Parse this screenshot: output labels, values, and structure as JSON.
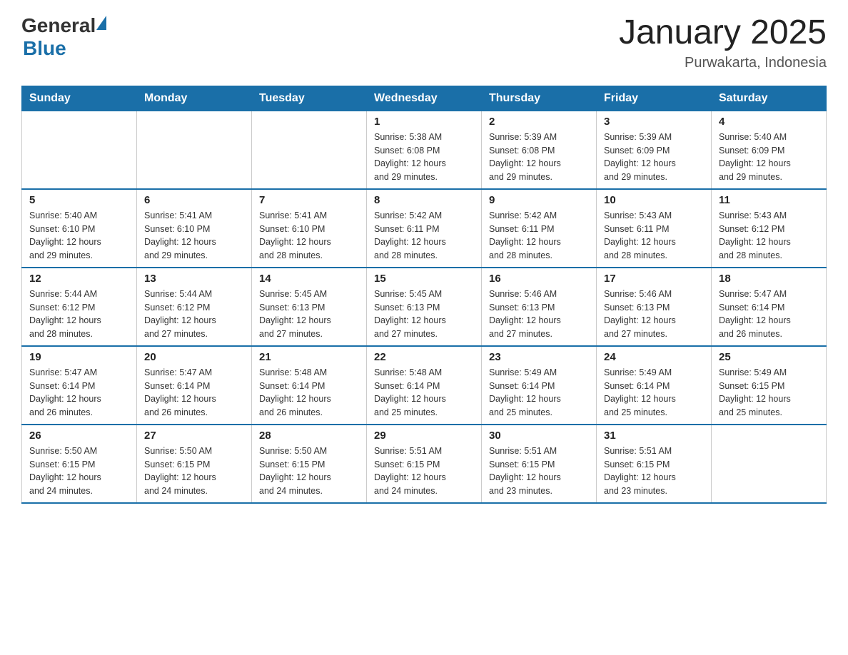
{
  "header": {
    "logo_general": "General",
    "logo_blue": "Blue",
    "month_title": "January 2025",
    "location": "Purwakarta, Indonesia"
  },
  "calendar": {
    "days_of_week": [
      "Sunday",
      "Monday",
      "Tuesday",
      "Wednesday",
      "Thursday",
      "Friday",
      "Saturday"
    ],
    "weeks": [
      [
        {
          "day": "",
          "info": ""
        },
        {
          "day": "",
          "info": ""
        },
        {
          "day": "",
          "info": ""
        },
        {
          "day": "1",
          "info": "Sunrise: 5:38 AM\nSunset: 6:08 PM\nDaylight: 12 hours\nand 29 minutes."
        },
        {
          "day": "2",
          "info": "Sunrise: 5:39 AM\nSunset: 6:08 PM\nDaylight: 12 hours\nand 29 minutes."
        },
        {
          "day": "3",
          "info": "Sunrise: 5:39 AM\nSunset: 6:09 PM\nDaylight: 12 hours\nand 29 minutes."
        },
        {
          "day": "4",
          "info": "Sunrise: 5:40 AM\nSunset: 6:09 PM\nDaylight: 12 hours\nand 29 minutes."
        }
      ],
      [
        {
          "day": "5",
          "info": "Sunrise: 5:40 AM\nSunset: 6:10 PM\nDaylight: 12 hours\nand 29 minutes."
        },
        {
          "day": "6",
          "info": "Sunrise: 5:41 AM\nSunset: 6:10 PM\nDaylight: 12 hours\nand 29 minutes."
        },
        {
          "day": "7",
          "info": "Sunrise: 5:41 AM\nSunset: 6:10 PM\nDaylight: 12 hours\nand 28 minutes."
        },
        {
          "day": "8",
          "info": "Sunrise: 5:42 AM\nSunset: 6:11 PM\nDaylight: 12 hours\nand 28 minutes."
        },
        {
          "day": "9",
          "info": "Sunrise: 5:42 AM\nSunset: 6:11 PM\nDaylight: 12 hours\nand 28 minutes."
        },
        {
          "day": "10",
          "info": "Sunrise: 5:43 AM\nSunset: 6:11 PM\nDaylight: 12 hours\nand 28 minutes."
        },
        {
          "day": "11",
          "info": "Sunrise: 5:43 AM\nSunset: 6:12 PM\nDaylight: 12 hours\nand 28 minutes."
        }
      ],
      [
        {
          "day": "12",
          "info": "Sunrise: 5:44 AM\nSunset: 6:12 PM\nDaylight: 12 hours\nand 28 minutes."
        },
        {
          "day": "13",
          "info": "Sunrise: 5:44 AM\nSunset: 6:12 PM\nDaylight: 12 hours\nand 27 minutes."
        },
        {
          "day": "14",
          "info": "Sunrise: 5:45 AM\nSunset: 6:13 PM\nDaylight: 12 hours\nand 27 minutes."
        },
        {
          "day": "15",
          "info": "Sunrise: 5:45 AM\nSunset: 6:13 PM\nDaylight: 12 hours\nand 27 minutes."
        },
        {
          "day": "16",
          "info": "Sunrise: 5:46 AM\nSunset: 6:13 PM\nDaylight: 12 hours\nand 27 minutes."
        },
        {
          "day": "17",
          "info": "Sunrise: 5:46 AM\nSunset: 6:13 PM\nDaylight: 12 hours\nand 27 minutes."
        },
        {
          "day": "18",
          "info": "Sunrise: 5:47 AM\nSunset: 6:14 PM\nDaylight: 12 hours\nand 26 minutes."
        }
      ],
      [
        {
          "day": "19",
          "info": "Sunrise: 5:47 AM\nSunset: 6:14 PM\nDaylight: 12 hours\nand 26 minutes."
        },
        {
          "day": "20",
          "info": "Sunrise: 5:47 AM\nSunset: 6:14 PM\nDaylight: 12 hours\nand 26 minutes."
        },
        {
          "day": "21",
          "info": "Sunrise: 5:48 AM\nSunset: 6:14 PM\nDaylight: 12 hours\nand 26 minutes."
        },
        {
          "day": "22",
          "info": "Sunrise: 5:48 AM\nSunset: 6:14 PM\nDaylight: 12 hours\nand 25 minutes."
        },
        {
          "day": "23",
          "info": "Sunrise: 5:49 AM\nSunset: 6:14 PM\nDaylight: 12 hours\nand 25 minutes."
        },
        {
          "day": "24",
          "info": "Sunrise: 5:49 AM\nSunset: 6:14 PM\nDaylight: 12 hours\nand 25 minutes."
        },
        {
          "day": "25",
          "info": "Sunrise: 5:49 AM\nSunset: 6:15 PM\nDaylight: 12 hours\nand 25 minutes."
        }
      ],
      [
        {
          "day": "26",
          "info": "Sunrise: 5:50 AM\nSunset: 6:15 PM\nDaylight: 12 hours\nand 24 minutes."
        },
        {
          "day": "27",
          "info": "Sunrise: 5:50 AM\nSunset: 6:15 PM\nDaylight: 12 hours\nand 24 minutes."
        },
        {
          "day": "28",
          "info": "Sunrise: 5:50 AM\nSunset: 6:15 PM\nDaylight: 12 hours\nand 24 minutes."
        },
        {
          "day": "29",
          "info": "Sunrise: 5:51 AM\nSunset: 6:15 PM\nDaylight: 12 hours\nand 24 minutes."
        },
        {
          "day": "30",
          "info": "Sunrise: 5:51 AM\nSunset: 6:15 PM\nDaylight: 12 hours\nand 23 minutes."
        },
        {
          "day": "31",
          "info": "Sunrise: 5:51 AM\nSunset: 6:15 PM\nDaylight: 12 hours\nand 23 minutes."
        },
        {
          "day": "",
          "info": ""
        }
      ]
    ]
  }
}
